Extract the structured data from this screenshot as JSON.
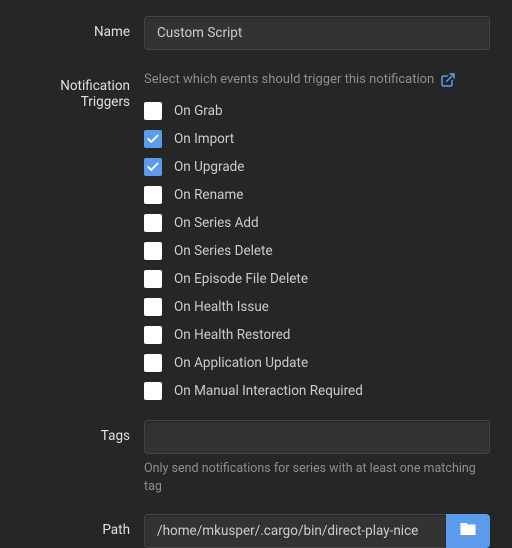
{
  "labels": {
    "name": "Name",
    "notification_triggers": "Notification Triggers",
    "tags": "Tags",
    "path": "Path"
  },
  "name_field": {
    "value": "Custom Script"
  },
  "triggers": {
    "help": "Select which events should trigger this notification",
    "items": [
      {
        "label": "On Grab",
        "checked": false
      },
      {
        "label": "On Import",
        "checked": true
      },
      {
        "label": "On Upgrade",
        "checked": true
      },
      {
        "label": "On Rename",
        "checked": false
      },
      {
        "label": "On Series Add",
        "checked": false
      },
      {
        "label": "On Series Delete",
        "checked": false
      },
      {
        "label": "On Episode File Delete",
        "checked": false
      },
      {
        "label": "On Health Issue",
        "checked": false
      },
      {
        "label": "On Health Restored",
        "checked": false
      },
      {
        "label": "On Application Update",
        "checked": false
      },
      {
        "label": "On Manual Interaction Required",
        "checked": false
      }
    ]
  },
  "tags": {
    "value": "",
    "hint": "Only send notifications for series with at least one matching tag"
  },
  "path": {
    "value": "/home/mkusper/.cargo/bin/direct-play-nice"
  },
  "colors": {
    "accent": "#5d9cec",
    "bg": "#262626",
    "input_bg": "#333333"
  }
}
